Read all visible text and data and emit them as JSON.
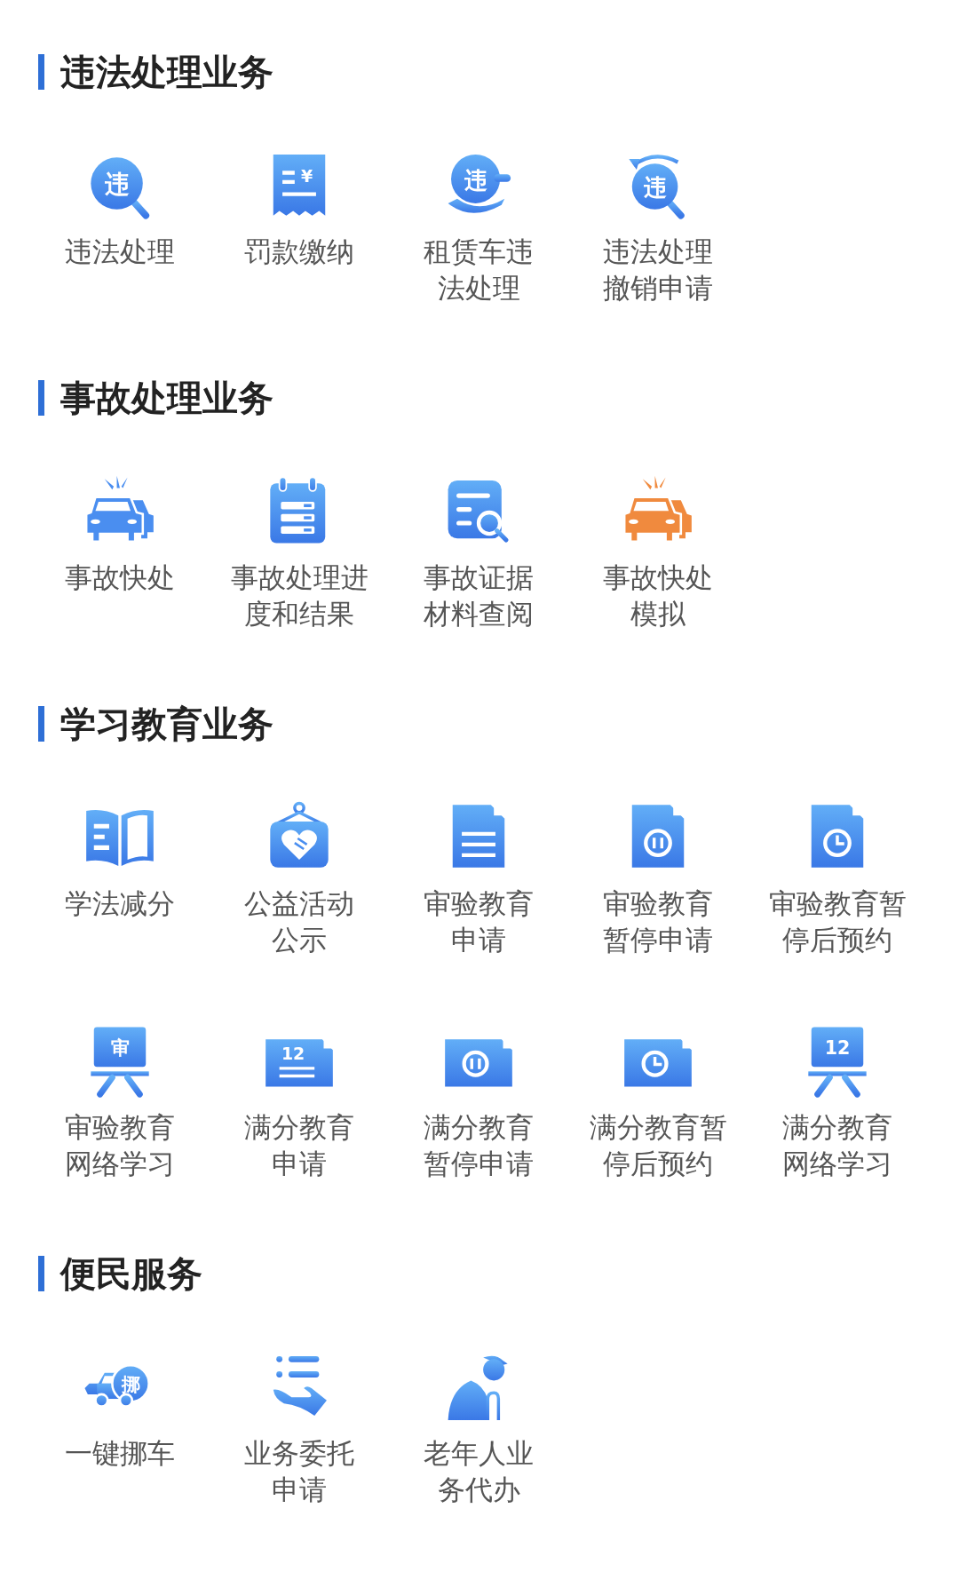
{
  "sections": [
    {
      "title": "违法处理业务",
      "items": [
        {
          "label": "违法处理",
          "kind": "magnifier-glyph",
          "glyph": "违"
        },
        {
          "label": "罚款缴纳",
          "kind": "receipt",
          "glyph": "¥"
        },
        {
          "label": "租赁车违法处理",
          "kind": "hand-glyph",
          "glyph": "违"
        },
        {
          "label": "违法处理撤销申请",
          "kind": "undo-glyph",
          "glyph": "违"
        }
      ]
    },
    {
      "title": "事故处理业务",
      "items": [
        {
          "label": "事故快处",
          "kind": "cars",
          "color": "#4a8ef0"
        },
        {
          "label": "事故处理进度和结果",
          "kind": "calendar"
        },
        {
          "label": "事故证据材料查阅",
          "kind": "doc-search"
        },
        {
          "label": "事故快处模拟",
          "kind": "cars",
          "color": "#f08a3e"
        }
      ]
    },
    {
      "title": "学习教育业务",
      "items": [
        {
          "label": "学法减分",
          "kind": "book"
        },
        {
          "label": "公益活动公示",
          "kind": "heart-sign"
        },
        {
          "label": "审验教育申请",
          "kind": "doc-lines"
        },
        {
          "label": "审验教育暂停申请",
          "kind": "doc-pause"
        },
        {
          "label": "审验教育暂停后预约",
          "kind": "doc-clock"
        },
        {
          "label": "审验教育网络学习",
          "kind": "easel",
          "glyph": "审"
        },
        {
          "label": "满分教育申请",
          "kind": "wide-doc-lines",
          "glyph": "12"
        },
        {
          "label": "满分教育暂停申请",
          "kind": "wide-doc-pause"
        },
        {
          "label": "满分教育暂停后预约",
          "kind": "wide-doc-clock"
        },
        {
          "label": "满分教育网络学习",
          "kind": "easel",
          "glyph": "12"
        }
      ]
    },
    {
      "title": "便民服务",
      "items": [
        {
          "label": "一键挪车",
          "kind": "truck",
          "glyph": "挪"
        },
        {
          "label": "业务委托申请",
          "kind": "hand-list"
        },
        {
          "label": "老年人业务代办",
          "kind": "elder"
        }
      ]
    }
  ]
}
